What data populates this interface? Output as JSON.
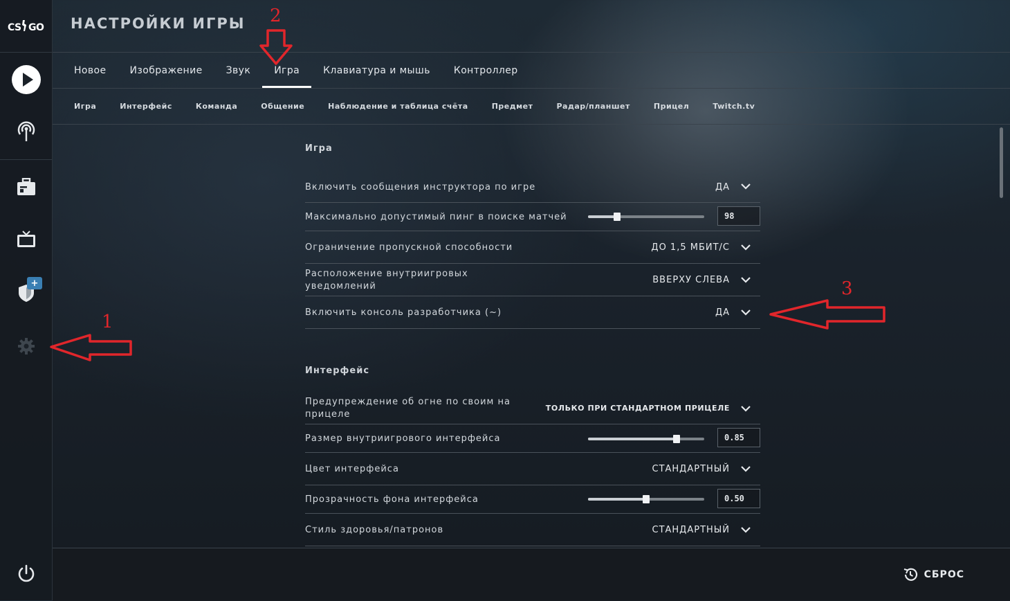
{
  "app": {
    "logo_text": "CS GO",
    "page_title": "НАСТРОЙКИ ИГРЫ"
  },
  "sidebar": {
    "items": [
      {
        "name": "play",
        "icon": "play-icon"
      },
      {
        "name": "broadcast",
        "icon": "antenna-icon"
      },
      {
        "name": "inventory",
        "icon": "briefcase-icon"
      },
      {
        "name": "watch",
        "icon": "tv-icon"
      },
      {
        "name": "operation",
        "icon": "shield-icon",
        "badge": "+"
      },
      {
        "name": "settings",
        "icon": "gear-icon"
      },
      {
        "name": "quit",
        "icon": "power-icon"
      }
    ]
  },
  "tabs": [
    "Новое",
    "Изображение",
    "Звук",
    "Игра",
    "Клавиатура и мышь",
    "Контроллер"
  ],
  "active_tab": "Игра",
  "subtabs": [
    "Игра",
    "Интерфейс",
    "Команда",
    "Общение",
    "Наблюдение и таблица счёта",
    "Предмет",
    "Радар/планшет",
    "Прицел",
    "Twitch.tv"
  ],
  "sections": {
    "game": {
      "title": "Игра",
      "rows": [
        {
          "label": "Включить сообщения инструктора по игре",
          "value": "ДА"
        },
        {
          "label": "Максимально допустимый пинг в поиске матчей",
          "value": "98",
          "slider_fraction": 0.25
        },
        {
          "label": "Ограничение пропускной способности",
          "value": "ДО 1,5 МБИТ/С"
        },
        {
          "label": "Расположение внутриигровых уведомлений",
          "value": "ВВЕРХУ СЛЕВА"
        },
        {
          "label": "Включить консоль разработчика (~)",
          "value": "ДА"
        }
      ]
    },
    "interface": {
      "title": "Интерфейс",
      "rows": [
        {
          "label": "Предупреждение об огне по своим на прицеле",
          "value": "ТОЛЬКО ПРИ СТАНДАРТНОМ ПРИЦЕЛЕ"
        },
        {
          "label": "Размер внутриигрового интерфейса",
          "value": "0.85",
          "slider_fraction": 0.76
        },
        {
          "label": "Цвет интерфейса",
          "value": "СТАНДАРТНЫЙ"
        },
        {
          "label": "Прозрачность фона интерфейса",
          "value": "0.50",
          "slider_fraction": 0.5
        },
        {
          "label": "Стиль здоровья/патронов",
          "value": "СТАНДАРТНЫЙ"
        }
      ]
    }
  },
  "footer": {
    "reset_label": "СБРОС"
  },
  "annotations": {
    "color": "#e1262b",
    "labels": [
      "1",
      "2",
      "3"
    ]
  }
}
